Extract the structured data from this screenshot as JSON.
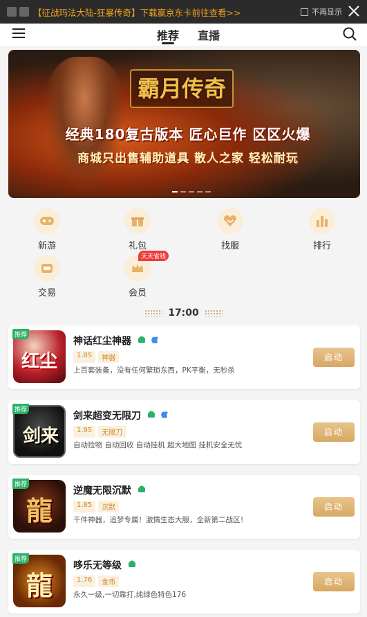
{
  "adbar": {
    "text": "【征战玛法大陆-狂暴传奇】下载赢京东卡前往查看>>",
    "no_more_label": "不再显示"
  },
  "header": {
    "tabs": [
      {
        "label": "推荐",
        "active": true
      },
      {
        "label": "直播",
        "active": false
      }
    ]
  },
  "banner": {
    "logo_text": "霸月传奇",
    "line1": "经典180复古版本 匠心巨作 区区火爆",
    "line2": "商城只出售辅助道具 散人之家 轻松耐玩",
    "page_count": 5,
    "active_page": 1
  },
  "quick_menu": [
    {
      "label": "新游",
      "icon": "gamepad-icon"
    },
    {
      "label": "礼包",
      "icon": "gift-icon"
    },
    {
      "label": "找服",
      "icon": "heart-shield-icon"
    },
    {
      "label": "排行",
      "icon": "bar-chart-icon"
    },
    {
      "label": "交易",
      "icon": "trade-icon"
    },
    {
      "label": "会员",
      "icon": "crown-icon",
      "badge": "天天省钱"
    }
  ],
  "time_divider": "17:00",
  "games": [
    {
      "badge": "推荐",
      "name": "神话红尘神器",
      "icon_text": "红尘",
      "platforms": [
        "android",
        "ios"
      ],
      "version": "1.85",
      "tag": "神器",
      "desc": "上百套装备，没有任何繁琐东西，PK平衡，无秒杀",
      "button": "启动"
    },
    {
      "badge": "推荐",
      "name": "剑来超变无限刀",
      "icon_text": "剑来",
      "platforms": [
        "android",
        "ios"
      ],
      "version": "1.95",
      "tag": "无限刀",
      "desc": "自动捡物 自动回收 自动挂机 超大地图 挂机安全无忧",
      "button": "启动"
    },
    {
      "badge": "推荐",
      "name": "逆魔无限沉默",
      "icon_text": "龍",
      "platforms": [
        "android"
      ],
      "version": "1.85",
      "tag": "沉默",
      "desc": "千件神器，追梦专属！激情生态大服，全新第二战区！",
      "button": "启动"
    },
    {
      "badge": "推荐",
      "name": "哆乐无等级",
      "icon_text": "龍",
      "platforms": [
        "android"
      ],
      "version": "1.76",
      "tag": "金币",
      "desc": "永久一级,一切靠打,纯绿色特色176",
      "button": "启动"
    }
  ]
}
